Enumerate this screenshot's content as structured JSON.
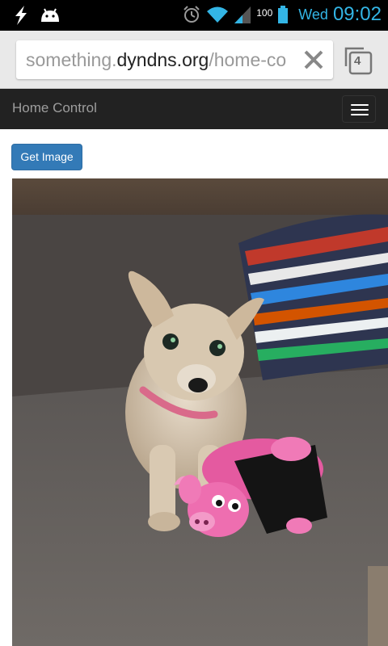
{
  "status_bar": {
    "battery_level": "100",
    "day": "Wed",
    "time": "09:02",
    "icons": [
      "usb-debug-icon",
      "android-icon",
      "alarm-icon",
      "wifi-icon",
      "signal-icon",
      "battery-icon"
    ],
    "accent_color": "#33b5e5"
  },
  "browser": {
    "url_prefix": "something.",
    "url_host": "dyndns.org",
    "url_path": "/home-co",
    "tab_count": "4"
  },
  "navbar": {
    "brand": "Home Control",
    "background": "#222222"
  },
  "main": {
    "get_image_label": "Get Image",
    "button_color": "#337ab7"
  }
}
